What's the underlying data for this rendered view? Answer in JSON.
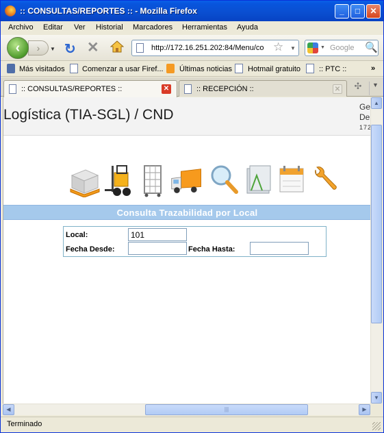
{
  "window": {
    "title": ":: CONSULTAS/REPORTES :: - Mozilla Firefox",
    "minimize_glyph": "_",
    "maximize_glyph": "□",
    "close_glyph": "✕"
  },
  "menu": [
    "Archivo",
    "Editar",
    "Ver",
    "Historial",
    "Marcadores",
    "Herramientas",
    "Ayuda"
  ],
  "nav": {
    "url": "http://172.16.251.202:84/Menu/co",
    "search_placeholder": "Google"
  },
  "bookmarks": [
    {
      "label": "Más visitados",
      "icon": "most-visited-icon"
    },
    {
      "label": "Comenzar a usar Firef...",
      "icon": "page-icon"
    },
    {
      "label": "Últimas noticias",
      "icon": "rss-feed-icon"
    },
    {
      "label": "Hotmail gratuito",
      "icon": "page-icon"
    },
    {
      "label": ":: PTC ::",
      "icon": "page-icon"
    }
  ],
  "bookmarks_more": "»",
  "tabs": [
    {
      "label": ":: CONSULTAS/REPORTES ::",
      "active": true
    },
    {
      "label": ":: RECEPCIÓN ::",
      "active": false
    }
  ],
  "page": {
    "header_title": "Logística (TIA-SGL) / CND",
    "header_right_lines": [
      "Ge",
      "De",
      "172"
    ],
    "icons": [
      "pallet-box-icon",
      "forklift-icon",
      "rolling-cage-icon",
      "delivery-truck-icon",
      "magnifier-icon",
      "folders-icon",
      "calendar-icon",
      "wrench-icon"
    ],
    "section_title": "Consulta Trazabilidad por Local",
    "form": {
      "local_label": "Local:",
      "local_value": "101",
      "fecha_desde_label": "Fecha Desde:",
      "fecha_desde_value": "",
      "fecha_hasta_label": "Fecha Hasta:",
      "fecha_hasta_value": ""
    }
  },
  "status": "Terminado"
}
